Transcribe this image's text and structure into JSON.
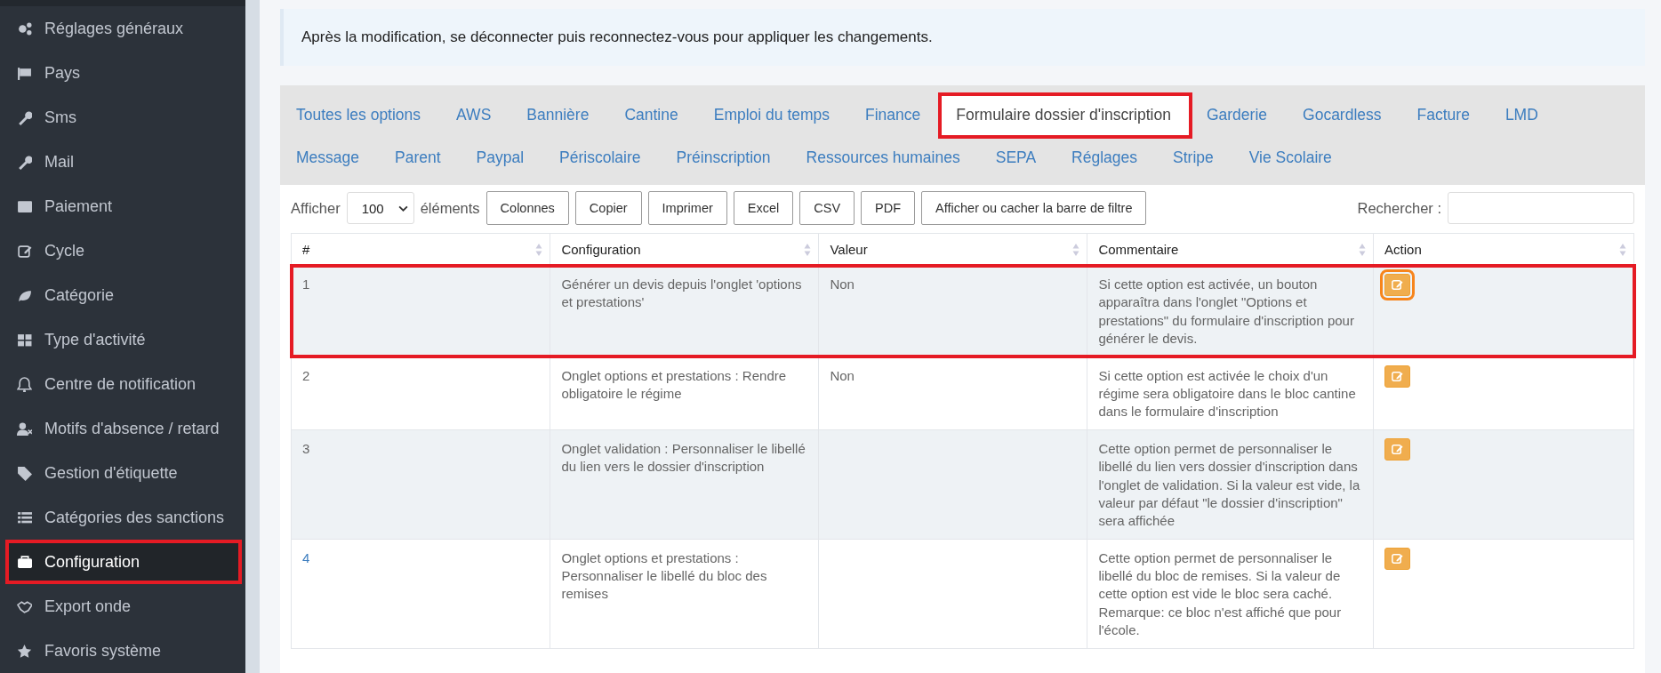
{
  "sidebar": {
    "items": [
      {
        "label": "Réglages généraux",
        "selected": false,
        "highlighted": false
      },
      {
        "label": "Pays",
        "selected": false,
        "highlighted": false
      },
      {
        "label": "Sms",
        "selected": false,
        "highlighted": false
      },
      {
        "label": "Mail",
        "selected": false,
        "highlighted": false
      },
      {
        "label": "Paiement",
        "selected": false,
        "highlighted": false
      },
      {
        "label": "Cycle",
        "selected": false,
        "highlighted": false
      },
      {
        "label": "Catégorie",
        "selected": false,
        "highlighted": false
      },
      {
        "label": "Type d'activité",
        "selected": false,
        "highlighted": false
      },
      {
        "label": "Centre de notification",
        "selected": false,
        "highlighted": false
      },
      {
        "label": "Motifs d'absence / retard",
        "selected": false,
        "highlighted": false
      },
      {
        "label": "Gestion d'étiquette",
        "selected": false,
        "highlighted": false
      },
      {
        "label": "Catégories des sanctions",
        "selected": false,
        "highlighted": false
      },
      {
        "label": "Configuration",
        "selected": true,
        "highlighted": true
      },
      {
        "label": "Export onde",
        "selected": false,
        "highlighted": false
      },
      {
        "label": "Favoris système",
        "selected": false,
        "highlighted": false
      }
    ]
  },
  "alert": "Après la modification, se déconnecter puis reconnectez-vous pour appliquer les changements.",
  "tabs": [
    {
      "label": "Toutes les options",
      "selected": false,
      "highlighted": false
    },
    {
      "label": "AWS",
      "selected": false,
      "highlighted": false
    },
    {
      "label": "Bannière",
      "selected": false,
      "highlighted": false
    },
    {
      "label": "Cantine",
      "selected": false,
      "highlighted": false
    },
    {
      "label": "Emploi du temps",
      "selected": false,
      "highlighted": false
    },
    {
      "label": "Finance",
      "selected": false,
      "highlighted": false
    },
    {
      "label": "Formulaire dossier d'inscription",
      "selected": true,
      "highlighted": true
    },
    {
      "label": "Garderie",
      "selected": false,
      "highlighted": false
    },
    {
      "label": "Gocardless",
      "selected": false,
      "highlighted": false
    },
    {
      "label": "Facture",
      "selected": false,
      "highlighted": false
    },
    {
      "label": "LMD",
      "selected": false,
      "highlighted": false
    },
    {
      "label": "Message",
      "selected": false,
      "highlighted": false
    },
    {
      "label": "Parent",
      "selected": false,
      "highlighted": false
    },
    {
      "label": "Paypal",
      "selected": false,
      "highlighted": false
    },
    {
      "label": "Périscolaire",
      "selected": false,
      "highlighted": false
    },
    {
      "label": "Préinscription",
      "selected": false,
      "highlighted": false
    },
    {
      "label": "Ressources humaines",
      "selected": false,
      "highlighted": false
    },
    {
      "label": "SEPA",
      "selected": false,
      "highlighted": false
    },
    {
      "label": "Réglages",
      "selected": false,
      "highlighted": false
    },
    {
      "label": "Stripe",
      "selected": false,
      "highlighted": false
    },
    {
      "label": "Vie Scolaire",
      "selected": false,
      "highlighted": false
    }
  ],
  "toolbar": {
    "show_label": "Afficher",
    "page_size": "100",
    "elements_label": "éléments",
    "buttons": [
      "Colonnes",
      "Copier",
      "Imprimer",
      "Excel",
      "CSV",
      "PDF",
      "Afficher ou cacher la barre de filtre"
    ],
    "search_label": "Rechercher :"
  },
  "table": {
    "columns": [
      "#",
      "Configuration",
      "Valeur",
      "Commentaire",
      "Action"
    ],
    "rows": [
      {
        "number": "1",
        "configuration": "Générer un devis depuis l'onglet 'options et prestations'",
        "value": "Non",
        "comment": "Si cette option est activée, un bouton apparaîtra dans l'onglet \"Options et prestations\" du formulaire d'inscription pour générer le devis.",
        "highlighted": true,
        "hovered": false
      },
      {
        "number": "2",
        "configuration": "Onglet options et prestations : Rendre obligatoire le régime",
        "value": "Non",
        "comment": "Si cette option est activée le choix d'un régime sera obligatoire dans le bloc cantine dans le formulaire d'inscription",
        "highlighted": false,
        "hovered": false
      },
      {
        "number": "3",
        "configuration": "Onglet validation : Personnaliser le libellé du lien vers le dossier d'inscription",
        "comment": "Cette option permet de personnaliser le libellé du lien vers dossier d'inscription dans l'onglet de validation. Si la valeur est vide, la valeur par défaut \"le dossier d'inscription\" sera affichée",
        "highlighted": false,
        "hovered": false
      },
      {
        "number": "4",
        "configuration": "Onglet options et prestations : Personnaliser le libellé du bloc des remises",
        "comment": "Cette option permet de personnaliser le libellé du bloc de remises. Si la valeur de cette option est vide le bloc sera caché. Remarque: ce bloc n'est affiché que pour l'école.",
        "highlighted": false,
        "hovered": true
      }
    ]
  }
}
